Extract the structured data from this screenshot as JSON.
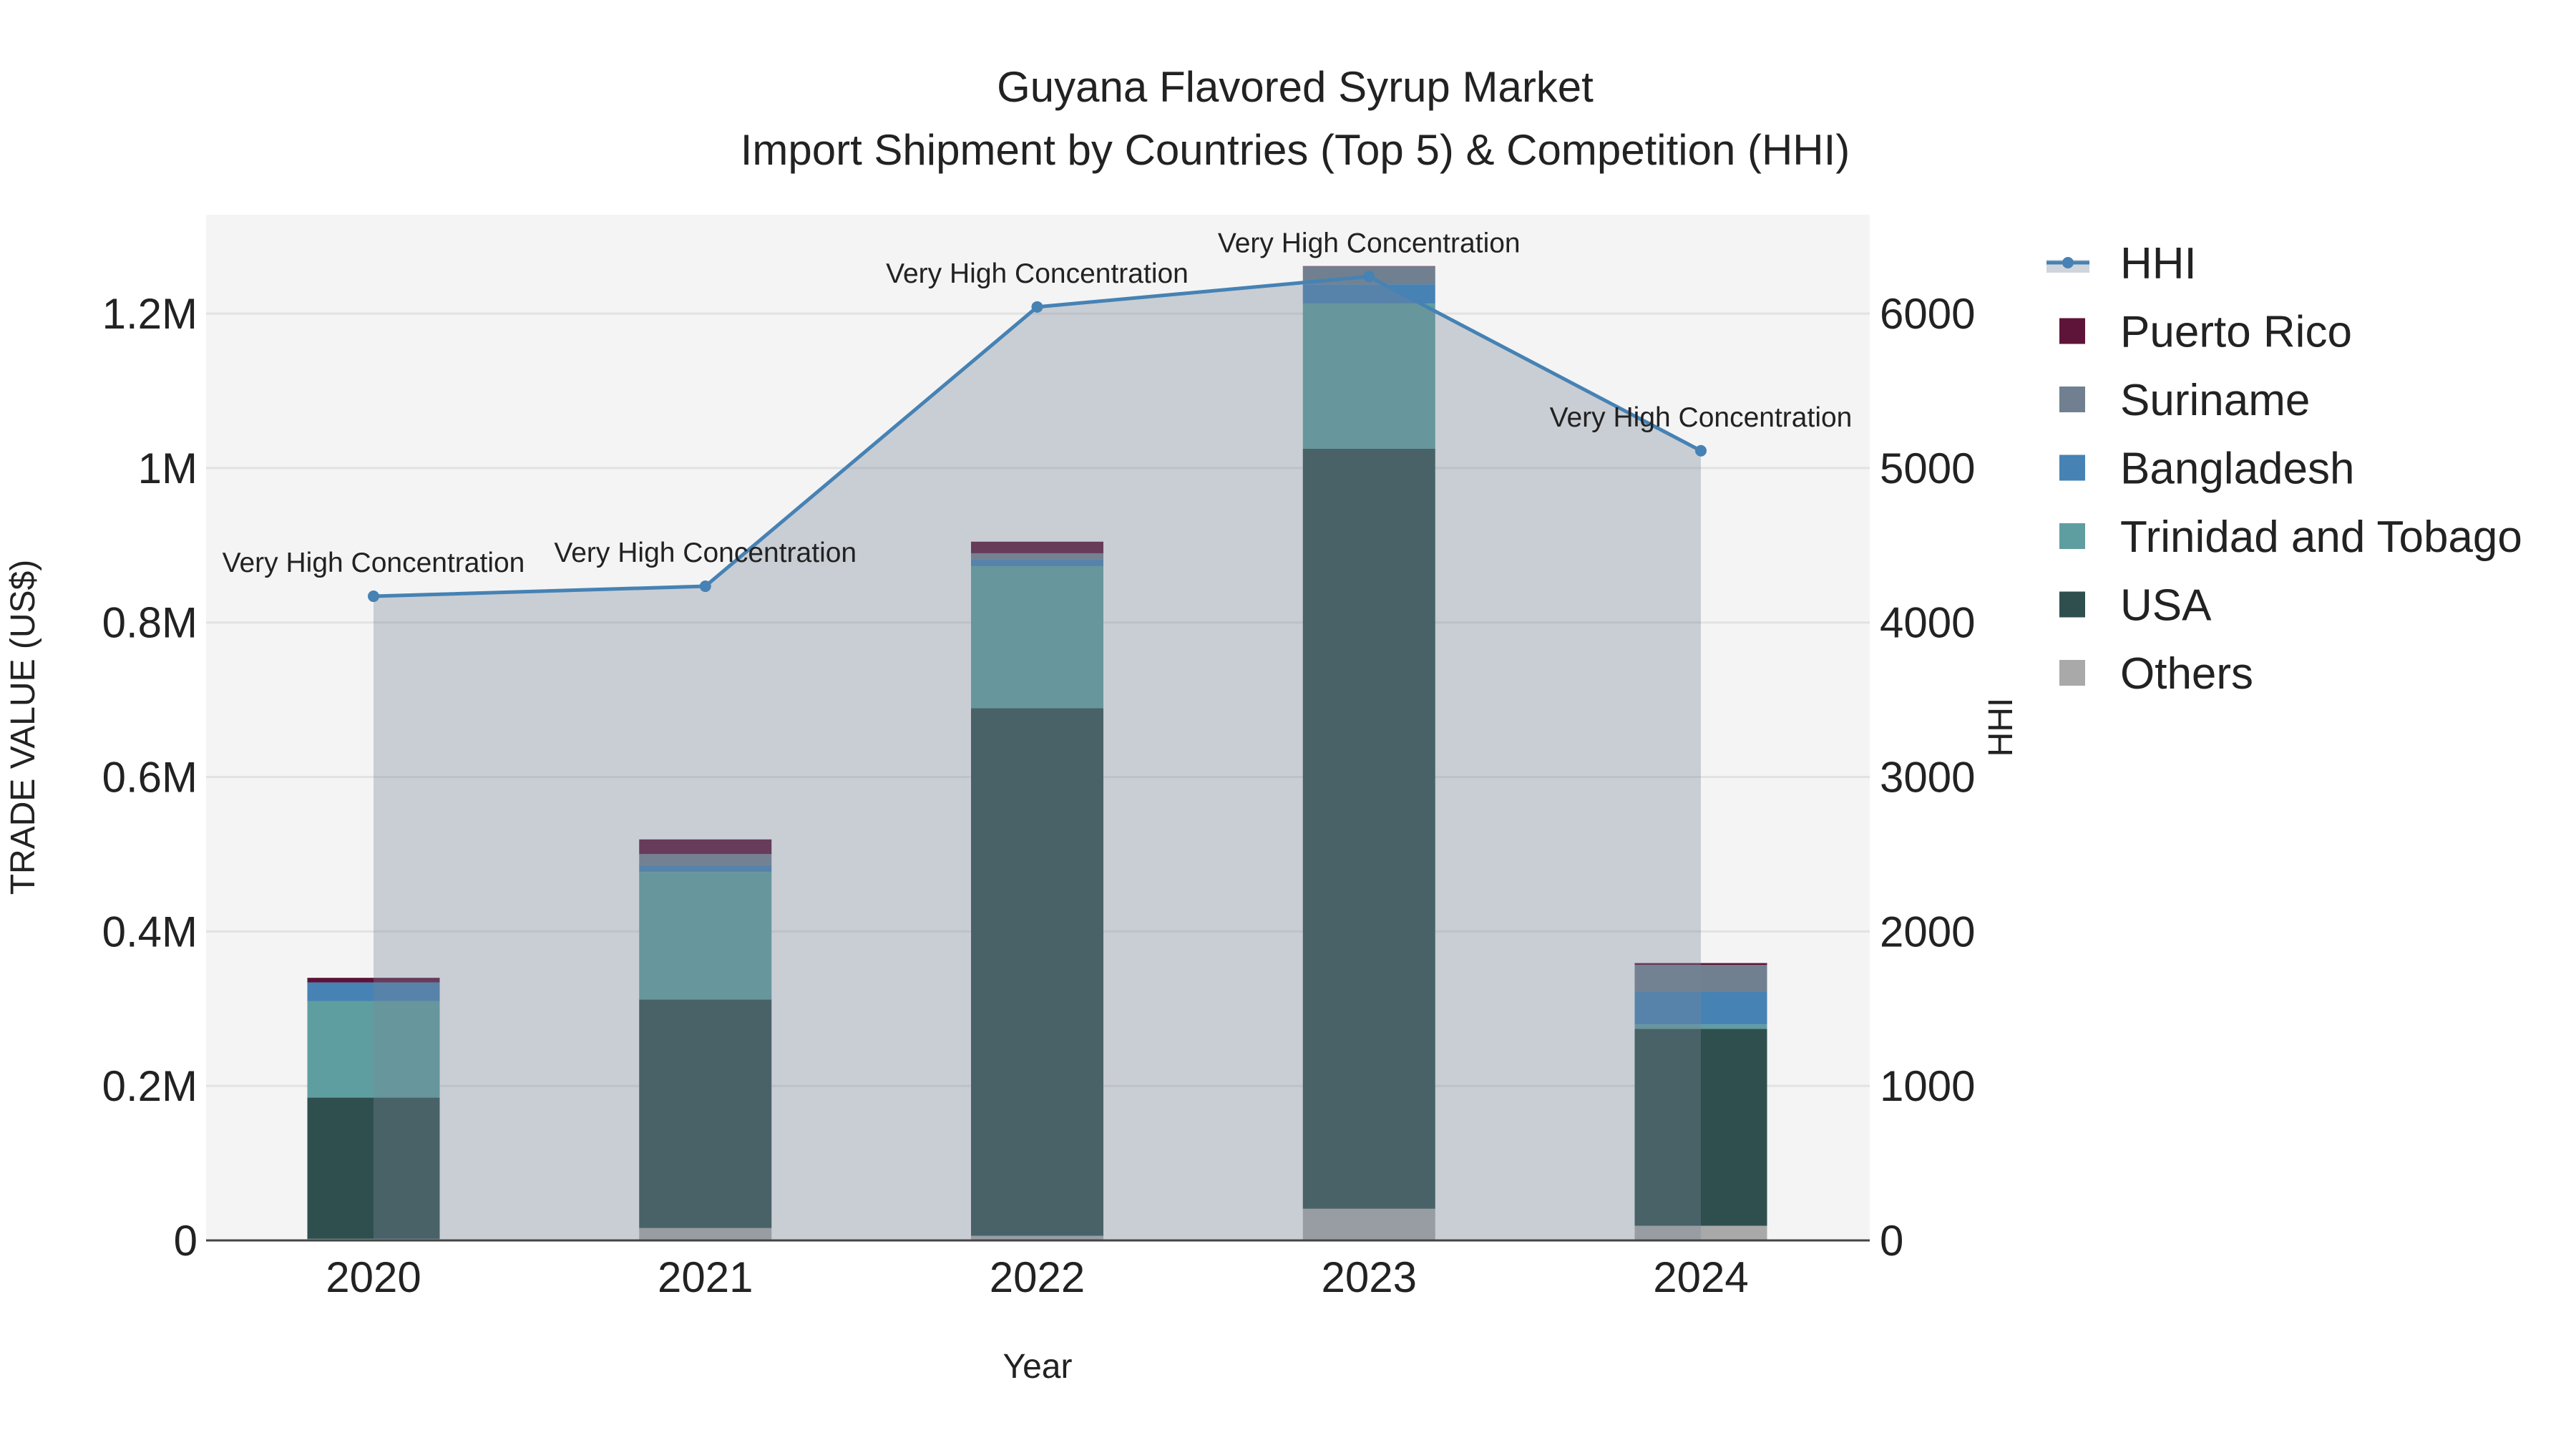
{
  "chart_data": {
    "type": "bar",
    "title_line1": "Guyana Flavored Syrup Market",
    "title_line2": "Import Shipment by Countries (Top 5) & Competition (HHI)",
    "xlabel": "Year",
    "ylabel": "TRADE VALUE (US$)",
    "y2label": "HHI",
    "categories": [
      "2020",
      "2021",
      "2022",
      "2023",
      "2024"
    ],
    "ylim": [
      0,
      1328000
    ],
    "y2lim": [
      0,
      6640
    ],
    "yticks": [
      0,
      200000,
      400000,
      600000,
      800000,
      1000000,
      1200000
    ],
    "ytick_labels": [
      "0",
      "0.2M",
      "0.4M",
      "0.6M",
      "0.8M",
      "1M",
      "1.2M"
    ],
    "y2ticks": [
      0,
      1000,
      2000,
      3000,
      4000,
      5000,
      6000
    ],
    "y2tick_labels": [
      "0",
      "1000",
      "2000",
      "3000",
      "4000",
      "5000",
      "6000"
    ],
    "grid": true,
    "legend_position": "right",
    "series": [
      {
        "name": "Others",
        "color": "#a9a9a9",
        "values": [
          2000,
          16000,
          6000,
          41000,
          19000
        ]
      },
      {
        "name": "USA",
        "color": "#2f4f4f",
        "values": [
          183000,
          296000,
          683000,
          984000,
          255000
        ]
      },
      {
        "name": "Trinidad and Tobago",
        "color": "#5f9ea0",
        "values": [
          125000,
          165000,
          184000,
          188000,
          5600
        ]
      },
      {
        "name": "Bangladesh",
        "color": "#4682b4",
        "values": [
          24000,
          8600,
          8700,
          25000,
          42000
        ]
      },
      {
        "name": "Suriname",
        "color": "#708090",
        "values": [
          0,
          14600,
          8000,
          23000,
          35000
        ]
      },
      {
        "name": "Puerto Rico",
        "color": "#5e1439",
        "values": [
          6000,
          19000,
          15000,
          500,
          2500
        ]
      }
    ],
    "hhi": {
      "name": "HHI",
      "color": "#4682b4",
      "values": [
        4170,
        4235,
        6043,
        6240,
        5112
      ],
      "annotations": [
        "Very High Concentration",
        "Very High Concentration",
        "Very High Concentration",
        "Very High Concentration",
        "Very High Concentration"
      ]
    },
    "legend_order": [
      "HHI",
      "Puerto Rico",
      "Suriname",
      "Bangladesh",
      "Trinidad and Tobago",
      "USA",
      "Others"
    ]
  }
}
